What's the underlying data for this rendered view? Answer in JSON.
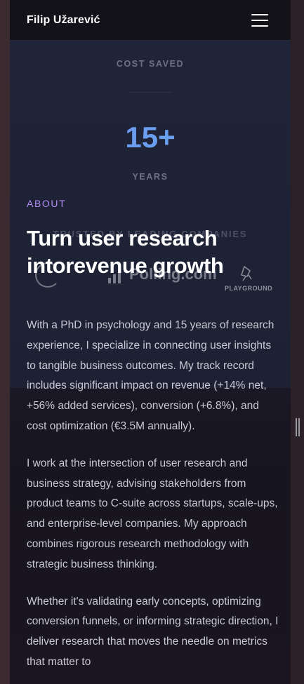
{
  "header": {
    "brand": "Filip Užarević"
  },
  "background_section": {
    "stat_label": "COST SAVED",
    "stat_value": "15+",
    "stat_unit": "YEARS",
    "trusted_heading": "TRUSTED BY LEADING COMPANIES",
    "logos": [
      {
        "name": "circle-logo"
      },
      {
        "name": "Polling.com",
        "text": "Polling.com"
      },
      {
        "name": "PLAYGROUND",
        "text": "PLAYGROUND"
      }
    ]
  },
  "about": {
    "label": "ABOUT",
    "headline": "Turn user research intorevenue growth",
    "paragraphs": [
      "With a PhD in psychology and 15 years of research experience, I specialize in connecting user insights to tangible business outcomes. My track record includes significant impact on revenue (+14% net, +56% added services), conversion (+6.8%), and cost optimization (€3.5M annually).",
      "I work at the intersection of user research and business strategy, advising stakeholders from product teams to C-suite across startups, scale-ups, and enterprise-level companies. My approach combines rigorous research methodology with strategic business thinking.",
      "Whether it's validating early concepts, optimizing conversion funnels, or informing strategic direction, I deliver research that moves the needle on metrics that matter to"
    ]
  },
  "colors": {
    "accent_purple": "#b18cf5",
    "stat_gradient_start": "#7b8cf0",
    "stat_gradient_end": "#5ab0f0"
  }
}
